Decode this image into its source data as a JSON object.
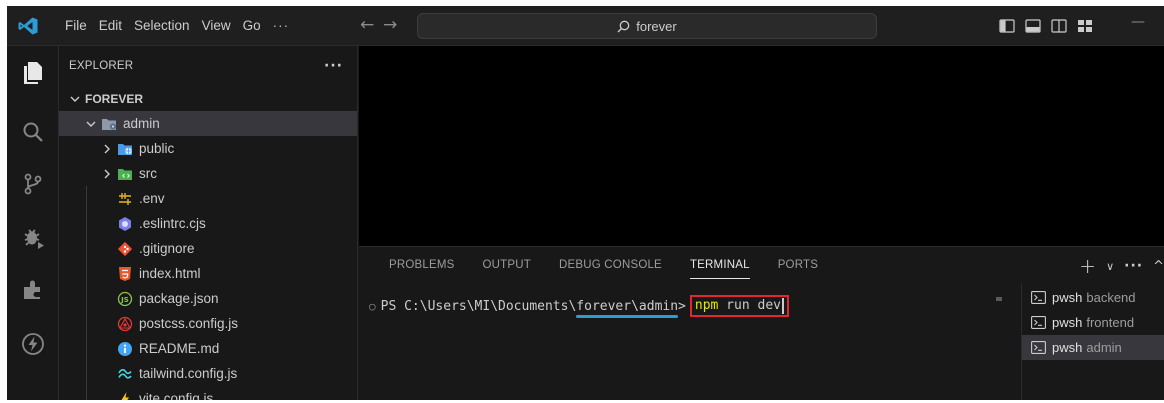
{
  "menu": [
    "File",
    "Edit",
    "Selection",
    "View",
    "Go",
    "···"
  ],
  "search": {
    "text": "forever"
  },
  "explorer": {
    "title": "EXPLORER",
    "more": "···",
    "root": "FOREVER",
    "items": [
      {
        "label": "admin",
        "icon": "folder-gear-icon",
        "expanded": true,
        "selected": true
      },
      {
        "label": "public",
        "icon": "folder-globe-icon",
        "expanded": false
      },
      {
        "label": "src",
        "icon": "folder-code-icon",
        "expanded": false
      },
      {
        "label": ".env",
        "icon": "env-icon"
      },
      {
        "label": ".eslintrc.cjs",
        "icon": "eslint-icon"
      },
      {
        "label": ".gitignore",
        "icon": "git-icon"
      },
      {
        "label": "index.html",
        "icon": "html-icon"
      },
      {
        "label": "package.json",
        "icon": "nodejs-icon"
      },
      {
        "label": "postcss.config.js",
        "icon": "postcss-icon"
      },
      {
        "label": "README.md",
        "icon": "info-icon"
      },
      {
        "label": "tailwind.config.js",
        "icon": "tailwind-icon"
      },
      {
        "label": "vite.config.js",
        "icon": "vite-icon"
      }
    ]
  },
  "panel": {
    "tabs": [
      "PROBLEMS",
      "OUTPUT",
      "DEBUG CONSOLE",
      "TERMINAL",
      "PORTS"
    ],
    "active_tab": "TERMINAL"
  },
  "terminal": {
    "prompt_prefix": "PS C:\\Users\\MI\\Documents\\",
    "prompt_highlight": "forever\\admin",
    "prompt_suffix": ">",
    "command_npm": "npm",
    "command_rest": " run dev"
  },
  "terminals": [
    {
      "name": "pwsh",
      "label": "backend",
      "active": false
    },
    {
      "name": "pwsh",
      "label": "frontend",
      "active": false
    },
    {
      "name": "pwsh",
      "label": "admin",
      "active": true
    }
  ],
  "colors": {
    "accent_blue": "#2f9bd6",
    "highlight_red": "#e0282e",
    "npm_yellow": "#e5e510"
  }
}
